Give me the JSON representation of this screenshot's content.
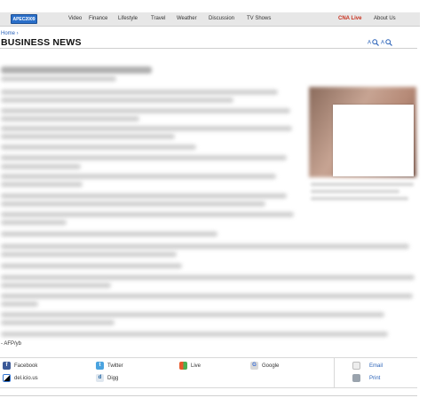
{
  "nav": {
    "logo_text": "APEC2009",
    "items": [
      "Video",
      "Finance",
      "Lifestyle",
      "Travel",
      "Weather",
      "Discussion",
      "TV Shows"
    ],
    "live_label": "CNA Live",
    "about_label": "About Us"
  },
  "breadcrumb": "Home ›",
  "page_title": "BUSINESS NEWS",
  "font_size_controls": {
    "small": "A",
    "large": "A"
  },
  "article": {
    "credit": "- AFP/yb"
  },
  "share": {
    "facebook": "Facebook",
    "twitter": "Twitter",
    "live": "Live",
    "google": "Google",
    "email": "Email",
    "delicious": "del.icio.us",
    "digg": "Digg",
    "print": "Print"
  },
  "colors": {
    "brand_blue": "#2a6fc9",
    "link_blue": "#2a62b8",
    "live_red": "#c8301e"
  },
  "icons": [
    "facebook-icon",
    "twitter-icon",
    "windows-live-icon",
    "google-icon",
    "email-icon",
    "delicious-icon",
    "digg-icon",
    "print-icon",
    "zoom-icon"
  ]
}
